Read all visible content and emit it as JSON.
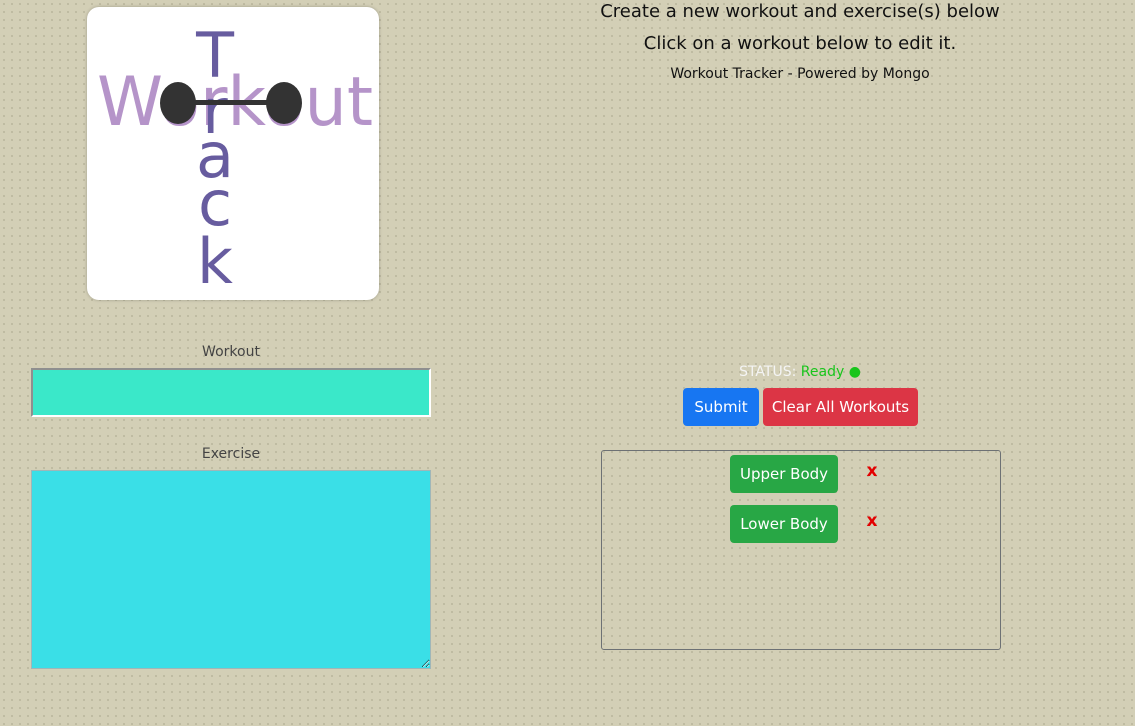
{
  "logo": {
    "word_horizontal": "Workout",
    "word_vertical": "Track",
    "colors": {
      "horizontal": "#b594c9",
      "vertical": "#675c9f",
      "dumbbell": "#333333"
    }
  },
  "header": {
    "line1": "Create a new workout and exercise(s) below",
    "line2": "Click on a workout below to edit it.",
    "line3": "Workout Tracker - Powered by Mongo"
  },
  "form": {
    "workout_label": "Workout",
    "workout_value": "",
    "exercise_label": "Exercise",
    "exercise_value": ""
  },
  "status": {
    "label": "STATUS:",
    "value": "Ready ●",
    "value_color": "#19c51c"
  },
  "buttons": {
    "submit": "Submit",
    "clear": "Clear All Workouts"
  },
  "workouts": [
    {
      "label": "Upper Body",
      "delete": "x"
    },
    {
      "label": "Lower Body",
      "delete": "x"
    }
  ],
  "colors": {
    "background": "#d3cfb6",
    "submit": "#1776f2",
    "clear": "#dc3545",
    "workout_button": "#28a745",
    "workout_input": "#3ae8c9",
    "exercise_input": "#3adfe7"
  }
}
